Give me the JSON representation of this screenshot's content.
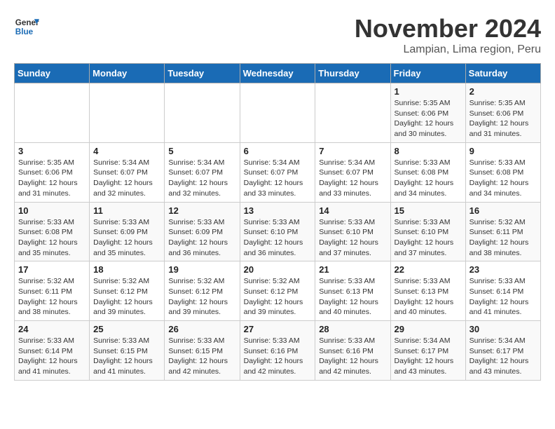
{
  "logo": {
    "line1": "General",
    "line2": "Blue"
  },
  "header": {
    "month": "November 2024",
    "location": "Lampian, Lima region, Peru"
  },
  "weekdays": [
    "Sunday",
    "Monday",
    "Tuesday",
    "Wednesday",
    "Thursday",
    "Friday",
    "Saturday"
  ],
  "weeks": [
    [
      {
        "day": "",
        "info": ""
      },
      {
        "day": "",
        "info": ""
      },
      {
        "day": "",
        "info": ""
      },
      {
        "day": "",
        "info": ""
      },
      {
        "day": "",
        "info": ""
      },
      {
        "day": "1",
        "info": "Sunrise: 5:35 AM\nSunset: 6:06 PM\nDaylight: 12 hours and 30 minutes."
      },
      {
        "day": "2",
        "info": "Sunrise: 5:35 AM\nSunset: 6:06 PM\nDaylight: 12 hours and 31 minutes."
      }
    ],
    [
      {
        "day": "3",
        "info": "Sunrise: 5:35 AM\nSunset: 6:06 PM\nDaylight: 12 hours and 31 minutes."
      },
      {
        "day": "4",
        "info": "Sunrise: 5:34 AM\nSunset: 6:07 PM\nDaylight: 12 hours and 32 minutes."
      },
      {
        "day": "5",
        "info": "Sunrise: 5:34 AM\nSunset: 6:07 PM\nDaylight: 12 hours and 32 minutes."
      },
      {
        "day": "6",
        "info": "Sunrise: 5:34 AM\nSunset: 6:07 PM\nDaylight: 12 hours and 33 minutes."
      },
      {
        "day": "7",
        "info": "Sunrise: 5:34 AM\nSunset: 6:07 PM\nDaylight: 12 hours and 33 minutes."
      },
      {
        "day": "8",
        "info": "Sunrise: 5:33 AM\nSunset: 6:08 PM\nDaylight: 12 hours and 34 minutes."
      },
      {
        "day": "9",
        "info": "Sunrise: 5:33 AM\nSunset: 6:08 PM\nDaylight: 12 hours and 34 minutes."
      }
    ],
    [
      {
        "day": "10",
        "info": "Sunrise: 5:33 AM\nSunset: 6:08 PM\nDaylight: 12 hours and 35 minutes."
      },
      {
        "day": "11",
        "info": "Sunrise: 5:33 AM\nSunset: 6:09 PM\nDaylight: 12 hours and 35 minutes."
      },
      {
        "day": "12",
        "info": "Sunrise: 5:33 AM\nSunset: 6:09 PM\nDaylight: 12 hours and 36 minutes."
      },
      {
        "day": "13",
        "info": "Sunrise: 5:33 AM\nSunset: 6:10 PM\nDaylight: 12 hours and 36 minutes."
      },
      {
        "day": "14",
        "info": "Sunrise: 5:33 AM\nSunset: 6:10 PM\nDaylight: 12 hours and 37 minutes."
      },
      {
        "day": "15",
        "info": "Sunrise: 5:33 AM\nSunset: 6:10 PM\nDaylight: 12 hours and 37 minutes."
      },
      {
        "day": "16",
        "info": "Sunrise: 5:32 AM\nSunset: 6:11 PM\nDaylight: 12 hours and 38 minutes."
      }
    ],
    [
      {
        "day": "17",
        "info": "Sunrise: 5:32 AM\nSunset: 6:11 PM\nDaylight: 12 hours and 38 minutes."
      },
      {
        "day": "18",
        "info": "Sunrise: 5:32 AM\nSunset: 6:12 PM\nDaylight: 12 hours and 39 minutes."
      },
      {
        "day": "19",
        "info": "Sunrise: 5:32 AM\nSunset: 6:12 PM\nDaylight: 12 hours and 39 minutes."
      },
      {
        "day": "20",
        "info": "Sunrise: 5:32 AM\nSunset: 6:12 PM\nDaylight: 12 hours and 39 minutes."
      },
      {
        "day": "21",
        "info": "Sunrise: 5:33 AM\nSunset: 6:13 PM\nDaylight: 12 hours and 40 minutes."
      },
      {
        "day": "22",
        "info": "Sunrise: 5:33 AM\nSunset: 6:13 PM\nDaylight: 12 hours and 40 minutes."
      },
      {
        "day": "23",
        "info": "Sunrise: 5:33 AM\nSunset: 6:14 PM\nDaylight: 12 hours and 41 minutes."
      }
    ],
    [
      {
        "day": "24",
        "info": "Sunrise: 5:33 AM\nSunset: 6:14 PM\nDaylight: 12 hours and 41 minutes."
      },
      {
        "day": "25",
        "info": "Sunrise: 5:33 AM\nSunset: 6:15 PM\nDaylight: 12 hours and 41 minutes."
      },
      {
        "day": "26",
        "info": "Sunrise: 5:33 AM\nSunset: 6:15 PM\nDaylight: 12 hours and 42 minutes."
      },
      {
        "day": "27",
        "info": "Sunrise: 5:33 AM\nSunset: 6:16 PM\nDaylight: 12 hours and 42 minutes."
      },
      {
        "day": "28",
        "info": "Sunrise: 5:33 AM\nSunset: 6:16 PM\nDaylight: 12 hours and 42 minutes."
      },
      {
        "day": "29",
        "info": "Sunrise: 5:34 AM\nSunset: 6:17 PM\nDaylight: 12 hours and 43 minutes."
      },
      {
        "day": "30",
        "info": "Sunrise: 5:34 AM\nSunset: 6:17 PM\nDaylight: 12 hours and 43 minutes."
      }
    ]
  ]
}
